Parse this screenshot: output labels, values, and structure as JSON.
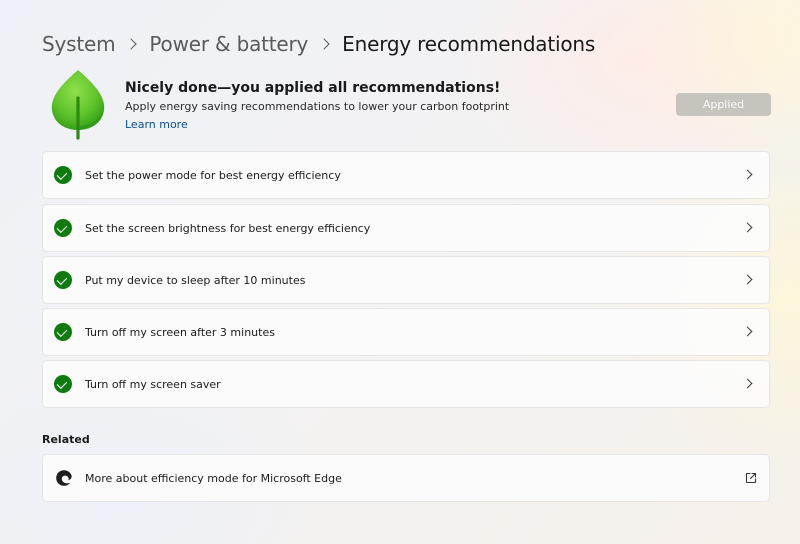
{
  "breadcrumb": {
    "items": [
      "System",
      "Power & battery"
    ],
    "current": "Energy recommendations"
  },
  "hero": {
    "icon": "leaf-icon",
    "title": "Nicely done—you applied all recommendations!",
    "subtitle": "Apply energy saving recommendations to lower your carbon footprint",
    "link": "Learn more",
    "button_label": "Applied"
  },
  "recommendations": [
    {
      "label": "Set the power mode for best energy efficiency",
      "status": "applied"
    },
    {
      "label": "Set the screen brightness for best energy efficiency",
      "status": "applied"
    },
    {
      "label": "Put my device to sleep after 10 minutes",
      "status": "applied"
    },
    {
      "label": "Turn off my screen after 3 minutes",
      "status": "applied"
    },
    {
      "label": "Turn off my screen saver",
      "status": "applied"
    }
  ],
  "related": {
    "title": "Related",
    "items": [
      {
        "label": "More about efficiency mode for Microsoft Edge",
        "icon": "edge-icon",
        "trailing_icon": "open-external-icon"
      }
    ]
  },
  "colors": {
    "check": "#0f7b0f",
    "leaf": "#5ec32a",
    "link": "#0a4f96",
    "applied_button": "#c6c4bd"
  }
}
